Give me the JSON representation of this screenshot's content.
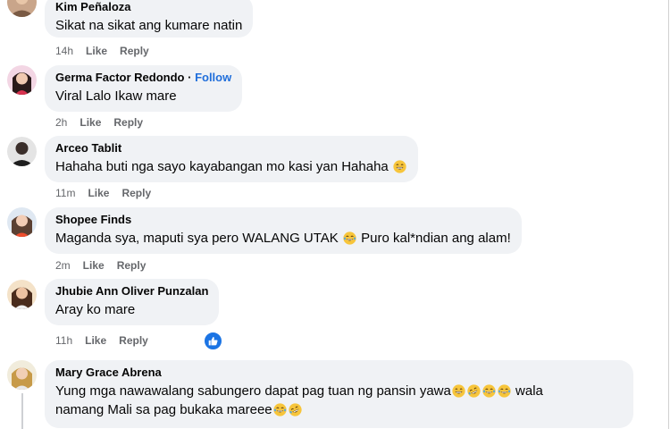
{
  "comments": [
    {
      "author": "Kim Peñaloza",
      "text": "Sikat na sikat ang kumare natin",
      "time": "14h",
      "like_label": "Like",
      "reply_label": "Reply"
    },
    {
      "author": "Germa Factor Redondo",
      "follow_separator": "·",
      "follow_label": "Follow",
      "text": "Viral Lalo Ikaw mare",
      "time": "2h",
      "like_label": "Like",
      "reply_label": "Reply"
    },
    {
      "author": "Arceo Tablit",
      "text": "Hahaha buti nga sayo kayabangan mo kasi yan Hahaha",
      "time": "11m",
      "like_label": "Like",
      "reply_label": "Reply"
    },
    {
      "author": "Shopee Finds",
      "text_before": "Maganda sya, maputi sya pero WALANG UTAK",
      "text_after": "Puro kal*ndian ang alam!",
      "time": "2m",
      "like_label": "Like",
      "reply_label": "Reply"
    },
    {
      "author": "Jhubie Ann Oliver Punzalan",
      "text": "Aray ko mare",
      "time": "11h",
      "like_label": "Like",
      "reply_label": "Reply",
      "reaction": "like-icon"
    },
    {
      "author": "Mary Grace Abrena",
      "text_line1": "Yung mga nawawalang sabungero dapat pag tuan ng pansin yawa",
      "text_line1_after": "wala",
      "text_line2": "namang Mali sa pag bukaka mareee"
    }
  ],
  "colors": {
    "bubble": "#f0f2f5",
    "meta": "#65676b",
    "follow": "#216fdb",
    "like_badge": "#1b74e4"
  }
}
